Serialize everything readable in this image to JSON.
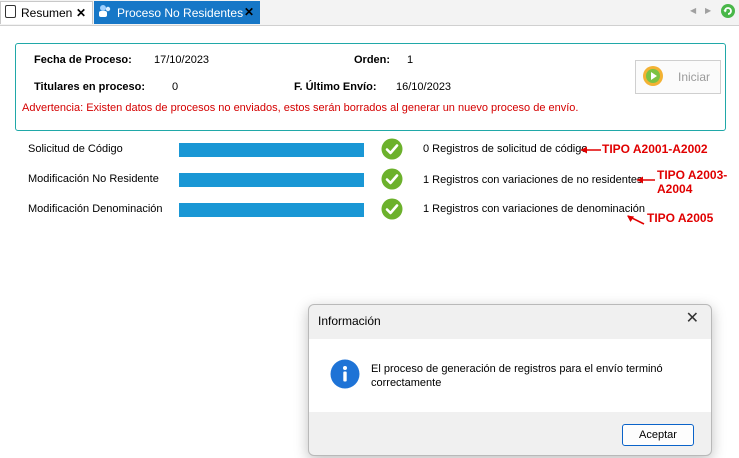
{
  "tabs": [
    {
      "label": "Resumen",
      "active": false
    },
    {
      "label": "Proceso No Residentes",
      "active": true
    }
  ],
  "header": {
    "fecha_proceso_label": "Fecha de Proceso:",
    "fecha_proceso_value": "17/10/2023",
    "orden_label": "Orden:",
    "orden_value": "1",
    "titulares_label": "Titulares en proceso:",
    "titulares_value": "0",
    "ultimo_envio_label": "F. Último Envío:",
    "ultimo_envio_value": "16/10/2023",
    "warning": "Advertencia: Existen datos de procesos no enviados, estos serán borrados al generar un nuevo proceso de envío.",
    "iniciar_label": "Iniciar"
  },
  "rows": [
    {
      "label": "Solicitud de Código",
      "progress": 1.0,
      "result": "0 Registros de solicitud de código",
      "tipo": "TIPO A2001-A2002"
    },
    {
      "label": "Modificación No Residente",
      "progress": 1.0,
      "result": "1 Registros con variaciones de no residentes",
      "tipo_line1": "TIPO A2003-",
      "tipo_line2": "A2004"
    },
    {
      "label": "Modificación Denominación",
      "progress": 1.0,
      "result": "1 Registros con variaciones de denominación",
      "tipo": "TIPO A2005"
    }
  ],
  "dialog": {
    "title": "Información",
    "message": "El proceso de generación de registros para el envío terminó correctamente",
    "ok_label": "Aceptar"
  },
  "colors": {
    "tab_active": "#1677c7",
    "panel_border": "#20a8a8",
    "warning": "#d40000",
    "progress": "#1a97d5",
    "annotation": "#e00000",
    "check": "#6cb12c"
  }
}
